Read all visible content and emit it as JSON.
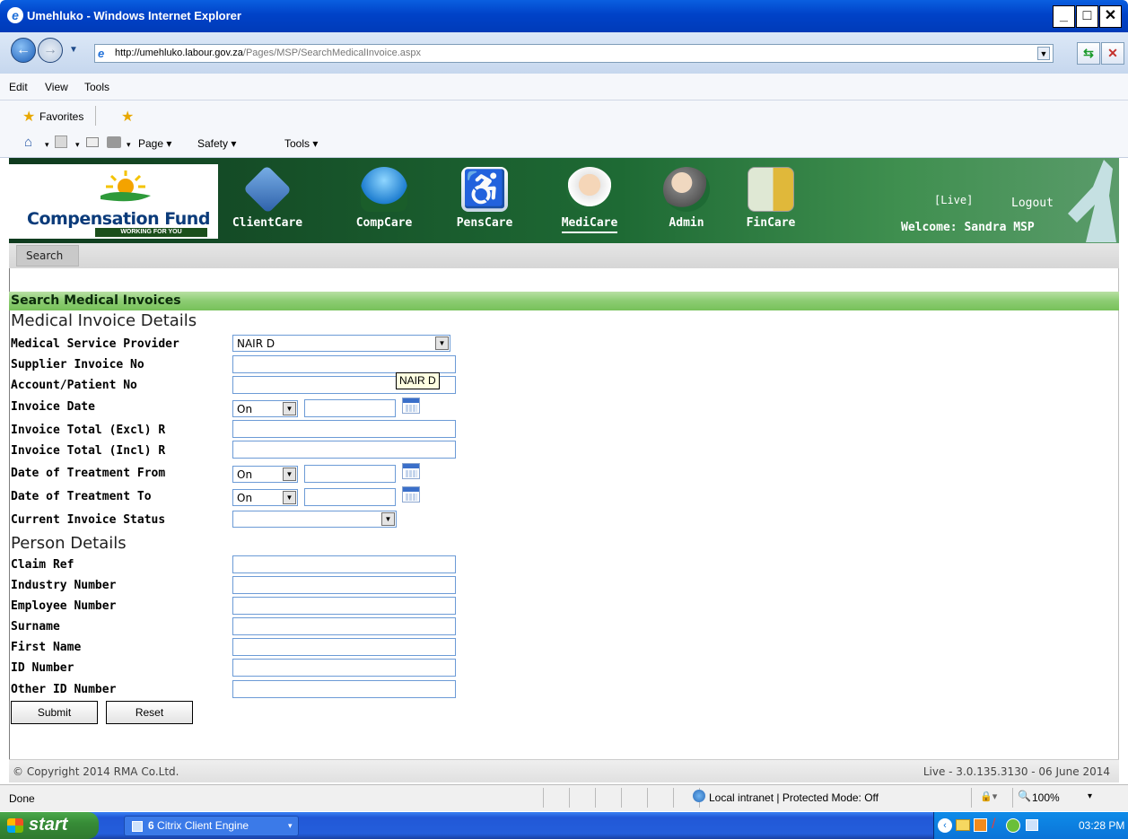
{
  "window": {
    "title": "Umehluko - Windows Internet Explorer"
  },
  "browser": {
    "url_host": "http://umehluko.labour.gov.za",
    "url_path": "/Pages/MSP/SearchMedicalInvoice.aspx",
    "menu": [
      "Edit",
      "View",
      "Tools"
    ],
    "favorites_label": "Favorites",
    "commands": [
      "Page ▾",
      "Safety ▾",
      "Tools ▾"
    ]
  },
  "app": {
    "logo_title": "Compensation Fund",
    "logo_tagline": "WORKING FOR YOU",
    "modules": [
      {
        "label": "ClientCare",
        "icon": "client-card-icon"
      },
      {
        "label": "CompCare",
        "icon": "umbrella-money-icon"
      },
      {
        "label": "PensCare",
        "icon": "wheelchair-icon"
      },
      {
        "label": "MediCare",
        "icon": "nurse-icon"
      },
      {
        "label": "Admin",
        "icon": "admin-user-icon"
      },
      {
        "label": "FinCare",
        "icon": "finance-coins-icon"
      }
    ],
    "env_tag": "[Live]",
    "logout_label": "Logout",
    "welcome": "Welcome: Sandra MSP",
    "submenu_search": "Search"
  },
  "page": {
    "section_title": "Search Medical Invoices",
    "group_invoice": "Medical Invoice Details",
    "group_person": "Person Details",
    "labels": {
      "msp": "Medical Service Provider",
      "supplier_invoice": "Supplier Invoice No",
      "account_patient": "Account/Patient No",
      "invoice_date": "Invoice Date",
      "total_excl": "Invoice Total (Excl) R",
      "total_incl": "Invoice Total (Incl) R",
      "treat_from": "Date of Treatment From",
      "treat_to": "Date of Treatment To",
      "status": "Current Invoice Status",
      "claim_ref": "Claim Ref",
      "industry_no": "Industry Number",
      "employee_no": "Employee Number",
      "surname": "Surname",
      "first_name": "First Name",
      "id_number": "ID Number",
      "other_id": "Other ID Number"
    },
    "msp_value": "NAIR D",
    "date_operator": "On",
    "status_value": "",
    "tooltip": "NAIR D",
    "submit_label": "Submit",
    "reset_label": "Reset"
  },
  "footer": {
    "copyright": "© Copyright 2014 RMA Co.Ltd.",
    "version": "Live - 3.0.135.3130 - 06 June 2014"
  },
  "statusbar": {
    "status": "Done",
    "zone": "Local intranet | Protected Mode: Off",
    "zoom": "100%"
  },
  "taskbar": {
    "start": "start",
    "task_count": "6",
    "task_label": "Citrix Client Engine",
    "clock": "03:28 PM"
  }
}
